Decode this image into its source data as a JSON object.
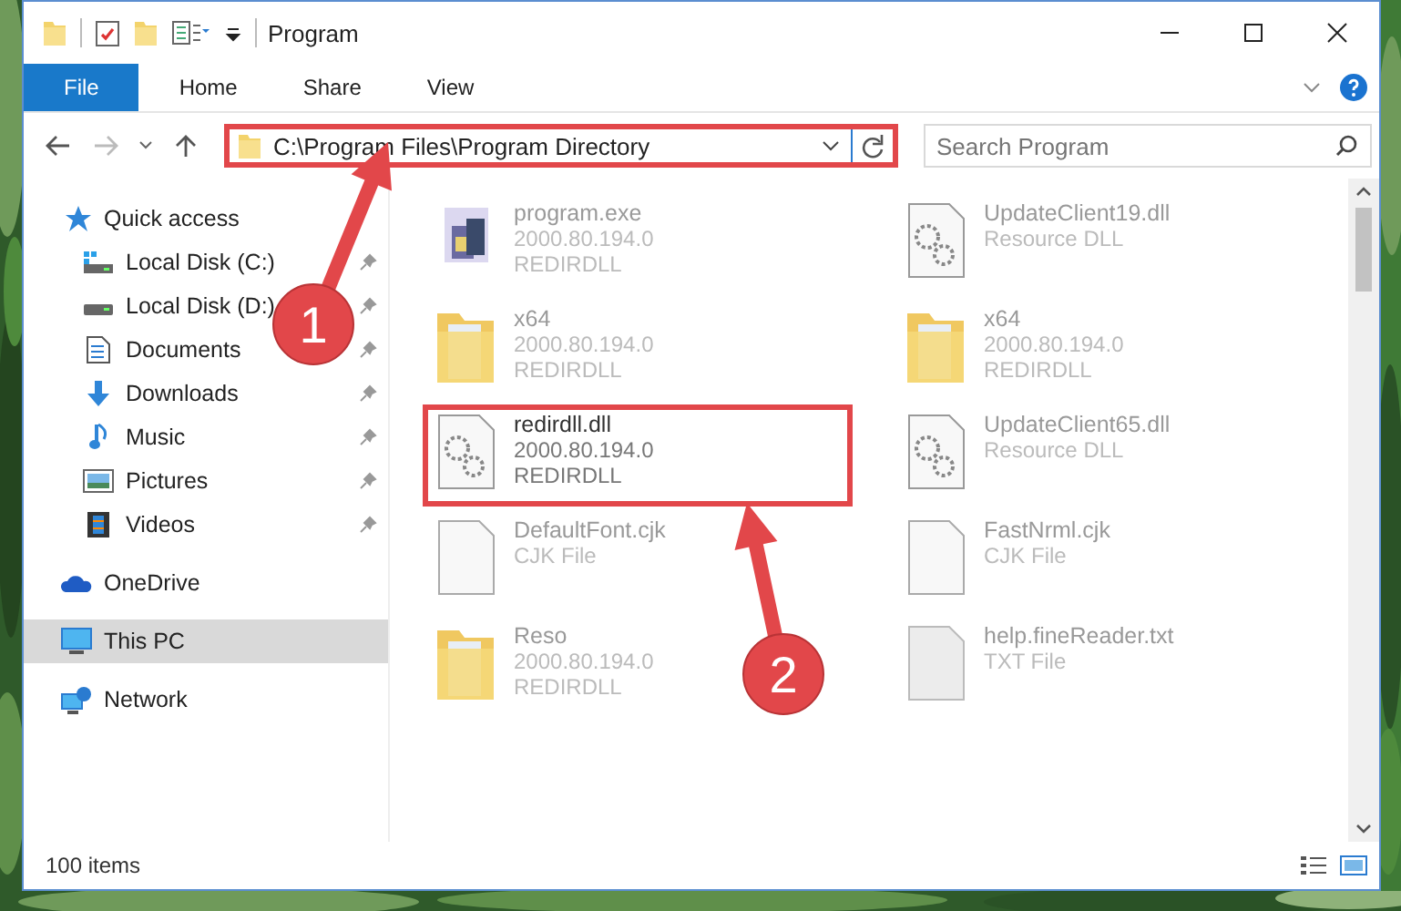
{
  "window": {
    "title": "Program"
  },
  "ribbon_tabs": [
    {
      "label": "File",
      "selected": true
    },
    {
      "label": "Home",
      "selected": false
    },
    {
      "label": "Share",
      "selected": false
    },
    {
      "label": "View",
      "selected": false
    }
  ],
  "address_bar": {
    "path": "C:\\Program Files\\Program Directory",
    "marked": true
  },
  "search": {
    "placeholder": "Search Program"
  },
  "sidebar": {
    "items": [
      {
        "label": "Quick access",
        "kind": "star",
        "selected": false,
        "children": [
          {
            "label": "Local Disk (C:)",
            "kind": "system",
            "pinned": true
          },
          {
            "label": "Local Disk (D:)",
            "kind": "drive",
            "pinned": true
          },
          {
            "label": "Documents",
            "kind": "documents",
            "pinned": true
          },
          {
            "label": "Downloads",
            "kind": "downloads",
            "pinned": true
          },
          {
            "label": "Music",
            "kind": "music",
            "pinned": true
          },
          {
            "label": "Pictures",
            "kind": "pictures",
            "pinned": true
          },
          {
            "label": "Videos",
            "kind": "videos",
            "pinned": true
          }
        ]
      },
      {
        "label": "OneDrive",
        "kind": "cloud",
        "selected": false
      },
      {
        "label": "This PC",
        "kind": "computer",
        "selected": true
      },
      {
        "label": "Network",
        "kind": "network",
        "selected": false
      }
    ]
  },
  "files": [
    {
      "name": "program.exe",
      "details": [
        "2000.80.194.0",
        "REDIRDLL"
      ],
      "kind": "exe",
      "marked": false
    },
    {
      "name": "UpdateClient19.dll",
      "details": [
        "Resource DLL"
      ],
      "kind": "dll",
      "marked": false
    },
    {
      "name": "x64",
      "details": [
        "2000.80.194.0",
        "REDIRDLL"
      ],
      "kind": "folder",
      "marked": false
    },
    {
      "name": "x64",
      "details": [
        "2000.80.194.0",
        "REDIRDLL"
      ],
      "kind": "folder",
      "marked": false
    },
    {
      "name": "redirdll.dll",
      "details": [
        "2000.80.194.0",
        "REDIRDLL"
      ],
      "kind": "dll",
      "marked": true
    },
    {
      "name": "UpdateClient65.dll",
      "details": [
        "Resource DLL"
      ],
      "kind": "dll",
      "marked": false
    },
    {
      "name": "DefaultFont.cjk",
      "details": [
        "CJK File"
      ],
      "kind": "file",
      "marked": false
    },
    {
      "name": "FastNrml.cjk",
      "details": [
        "CJK File"
      ],
      "kind": "file",
      "marked": false
    },
    {
      "name": "Reso",
      "details": [
        "2000.80.194.0",
        "REDIRDLL"
      ],
      "kind": "folder",
      "marked": false
    },
    {
      "name": "help.fineReader.txt",
      "details": [
        "TXT File"
      ],
      "kind": "txt",
      "marked": false
    }
  ],
  "status_bar": {
    "count": "100 items"
  },
  "annotations": [
    {
      "number": "1"
    },
    {
      "number": "2"
    }
  ]
}
